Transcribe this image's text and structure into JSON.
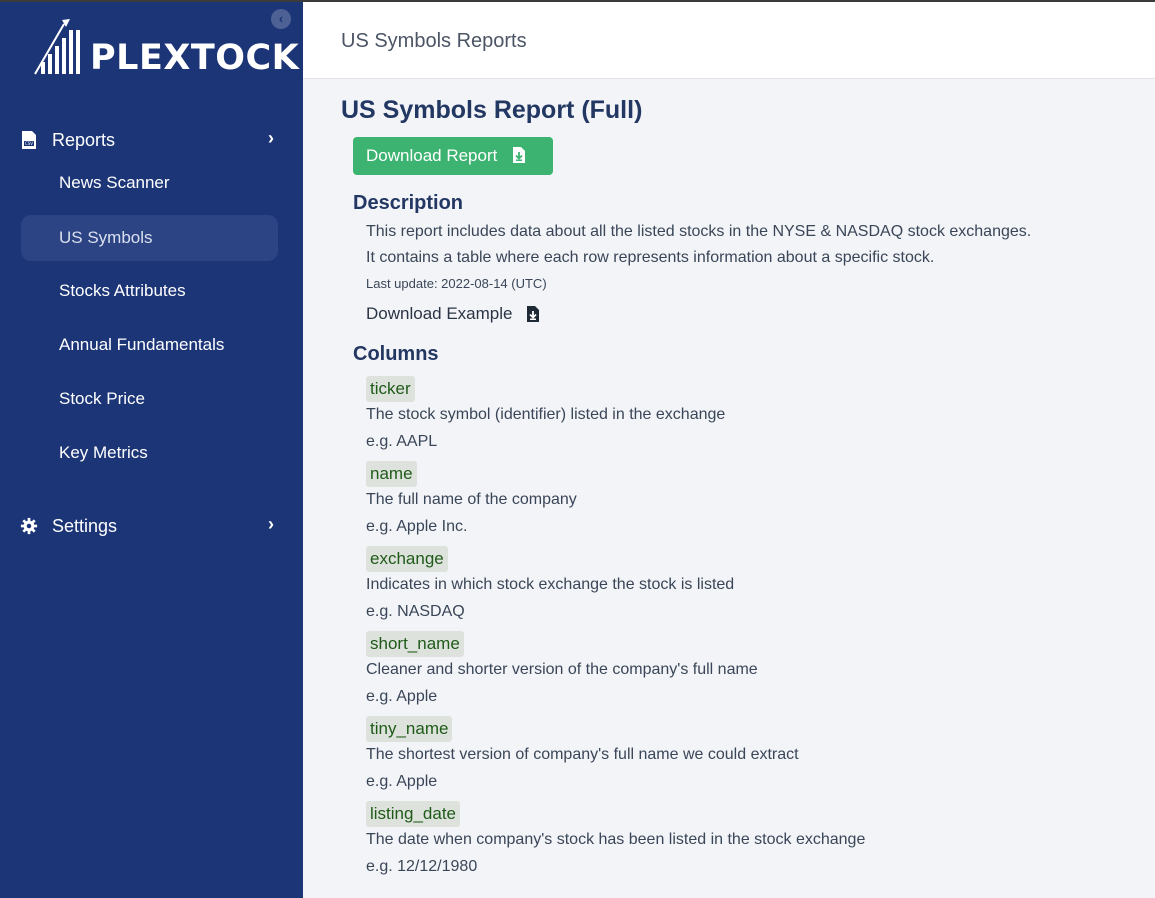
{
  "app": {
    "logo_text": "PLEXTOCK"
  },
  "sidebar": {
    "reports_label": "Reports",
    "items": [
      {
        "label": "News Scanner"
      },
      {
        "label": "US Symbols"
      },
      {
        "label": "Stocks Attributes"
      },
      {
        "label": "Annual Fundamentals"
      },
      {
        "label": "Stock Price"
      },
      {
        "label": "Key Metrics"
      }
    ],
    "active_item": "US Symbols",
    "settings_label": "Settings",
    "collapse_icon": "chevron-left-icon"
  },
  "header": {
    "title": "US Symbols Reports"
  },
  "main": {
    "title": "US Symbols Report (Full)",
    "download_button": "Download Report",
    "description_heading": "Description",
    "description_lines": [
      "This report includes data about all the listed stocks in the NYSE & NASDAQ stock exchanges.",
      "It contains a table where each row represents information about a specific stock."
    ],
    "last_update": "Last update: 2022-08-14 (UTC)",
    "download_example": "Download Example",
    "columns_heading": "Columns",
    "columns": [
      {
        "name": "ticker",
        "description": "The stock symbol (identifier) listed in the exchange",
        "example": "e.g. AAPL"
      },
      {
        "name": "name",
        "description": "The full name of the company",
        "example": "e.g. Apple Inc."
      },
      {
        "name": "exchange",
        "description": "Indicates in which stock exchange the stock is listed",
        "example": "e.g. NASDAQ"
      },
      {
        "name": "short_name",
        "description": "Cleaner and shorter version of the company's full name",
        "example": "e.g. Apple"
      },
      {
        "name": "tiny_name",
        "description": "The shortest version of company's full name we could extract",
        "example": "e.g. Apple"
      },
      {
        "name": "listing_date",
        "description": "The date when company's stock has been listed in the stock exchange",
        "example": "e.g. 12/12/1980"
      }
    ]
  },
  "colors": {
    "sidebar_bg": "#1c3577",
    "accent_green": "#3cb371",
    "heading": "#233763",
    "tag_bg": "#dde3dc",
    "tag_text": "#1f5a19"
  }
}
